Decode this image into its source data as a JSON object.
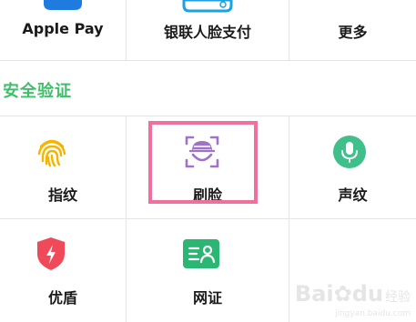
{
  "top_row": {
    "items": [
      {
        "label": "Apple Pay",
        "icon": "apple-pay-icon"
      },
      {
        "label": "银联人脸支付",
        "icon": "unionpay-face-icon"
      },
      {
        "label": "更多",
        "icon": ""
      }
    ]
  },
  "security": {
    "title": "安全验证",
    "items": [
      {
        "label": "指纹",
        "icon": "fingerprint-icon",
        "color": "#f5b400"
      },
      {
        "label": "刷脸",
        "icon": "face-scan-icon",
        "color": "#a073c8"
      },
      {
        "label": "声纹",
        "icon": "microphone-icon",
        "color": "#3fbf8a"
      },
      {
        "label": "优盾",
        "icon": "shield-icon",
        "color": "#f04a5a"
      },
      {
        "label": "网证",
        "icon": "id-card-icon",
        "color": "#2bb673"
      }
    ]
  },
  "highlight_color": "#ef6f9d",
  "watermark": {
    "brand": "Bai",
    "paw": "du",
    "suffix": "经验",
    "sub": "jingyan.baidu.com"
  }
}
